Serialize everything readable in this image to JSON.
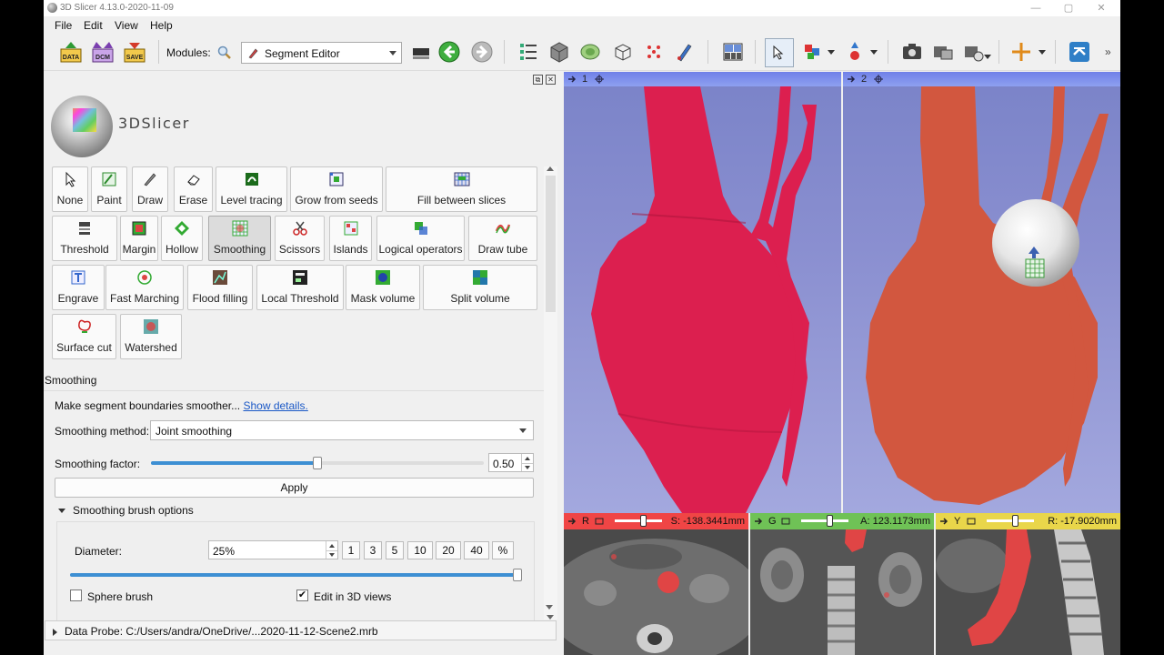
{
  "window": {
    "title": "3D Slicer 4.13.0-2020-11-09"
  },
  "menu": [
    "File",
    "Edit",
    "View",
    "Help"
  ],
  "toolbar": {
    "data_label": "DATA",
    "dcm_label": "DCM",
    "save_label": "SAVE",
    "modules_label": "Modules:",
    "current_module": "Segment Editor"
  },
  "logo": {
    "text": "3DSlicer"
  },
  "effects": [
    {
      "label": "None",
      "icon": "arrow-cursor-icon"
    },
    {
      "label": "Paint",
      "icon": "paint-brush-icon"
    },
    {
      "label": "Draw",
      "icon": "pencil-icon"
    },
    {
      "label": "Erase",
      "icon": "eraser-icon"
    },
    {
      "label": "Level tracing",
      "icon": "level-tracing-icon"
    },
    {
      "label": "Grow from seeds",
      "icon": "grow-from-seeds-icon"
    },
    {
      "label": "Fill between slices",
      "icon": "fill-between-slices-icon"
    },
    {
      "label": "Threshold",
      "icon": "threshold-icon"
    },
    {
      "label": "Margin",
      "icon": "margin-icon"
    },
    {
      "label": "Hollow",
      "icon": "hollow-icon"
    },
    {
      "label": "Smoothing",
      "icon": "smoothing-icon"
    },
    {
      "label": "Scissors",
      "icon": "scissors-icon"
    },
    {
      "label": "Islands",
      "icon": "islands-icon"
    },
    {
      "label": "Logical operators",
      "icon": "logical-operators-icon"
    },
    {
      "label": "Draw tube",
      "icon": "draw-tube-icon"
    },
    {
      "label": "Engrave",
      "icon": "engrave-icon"
    },
    {
      "label": "Fast Marching",
      "icon": "fast-marching-icon"
    },
    {
      "label": "Flood filling",
      "icon": "flood-filling-icon"
    },
    {
      "label": "Local Threshold",
      "icon": "local-threshold-icon"
    },
    {
      "label": "Mask volume",
      "icon": "mask-volume-icon"
    },
    {
      "label": "Split volume",
      "icon": "split-volume-icon"
    },
    {
      "label": "Surface cut",
      "icon": "surface-cut-icon"
    },
    {
      "label": "Watershed",
      "icon": "watershed-icon"
    }
  ],
  "smoothing": {
    "section_title": "Smoothing",
    "description": "Make segment boundaries smoother...",
    "details_link": "Show details.",
    "method_label": "Smoothing method:",
    "method_value": "Joint smoothing",
    "factor_label": "Smoothing factor:",
    "factor_value": "0.50",
    "factor_fraction": 0.5,
    "apply_label": "Apply",
    "brush_options_label": "Smoothing brush options",
    "diameter_label": "Diameter:",
    "diameter_value": "25%",
    "diameter_presets": [
      "1",
      "3",
      "5",
      "10",
      "20",
      "40",
      "%"
    ],
    "diameter_slider_fraction": 1.0,
    "sphere_brush_label": "Sphere brush",
    "sphere_brush_checked": false,
    "edit_3d_label": "Edit in 3D views",
    "edit_3d_checked": true
  },
  "data_probe": {
    "label": "Data Probe: C:/Users/andra/OneDrive/...2020-11-12-Scene2.mrb"
  },
  "views": {
    "view1": {
      "number": "1",
      "segment_color": "#dc1f4f"
    },
    "view2": {
      "number": "2",
      "segment_color": "#d2573f"
    }
  },
  "slices": [
    {
      "letter": "R",
      "value": "S: -138.3441mm",
      "color": "#f04545"
    },
    {
      "letter": "G",
      "value": "A: 123.1173mm",
      "color": "#6fc256"
    },
    {
      "letter": "Y",
      "value": "R: -17.9020mm",
      "color": "#e9d64a"
    }
  ]
}
